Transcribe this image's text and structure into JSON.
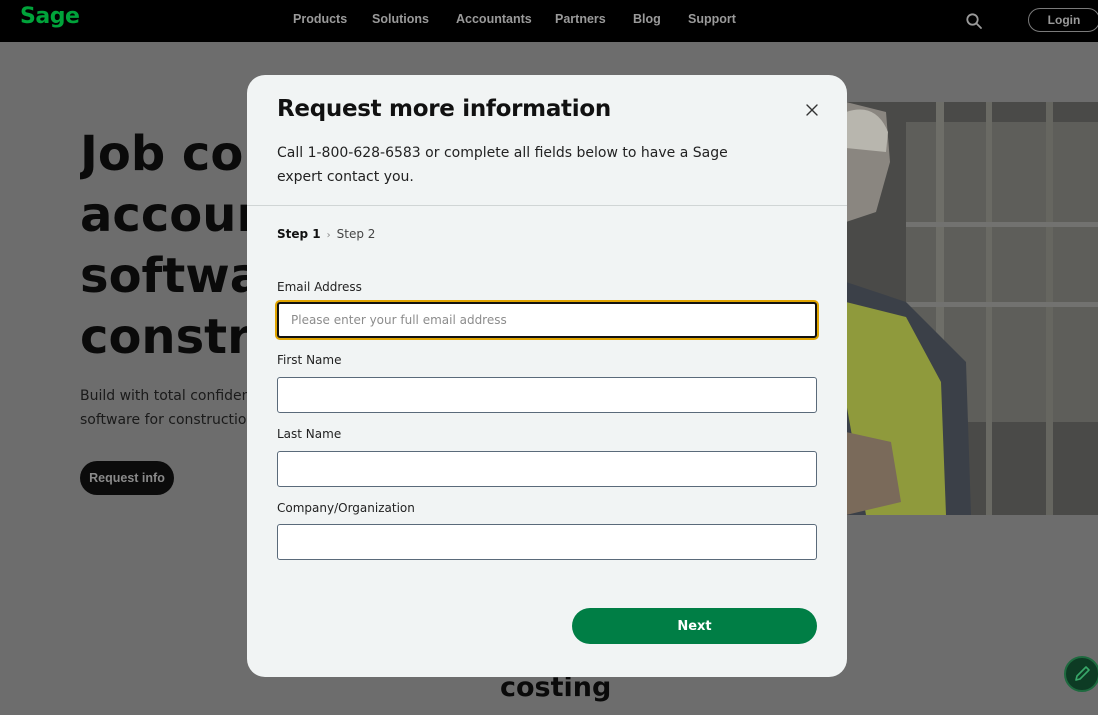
{
  "nav": {
    "logo": "Sage",
    "items": [
      "Products",
      "Solutions",
      "Accountants",
      "Partners",
      "Blog",
      "Support"
    ],
    "login_label": "Login",
    "search_icon": "search-icon"
  },
  "hero": {
    "heading_lines": [
      "Job co",
      "accour",
      "softwa",
      "constr"
    ],
    "text_lines": [
      "Build with total confiden",
      "software for construction"
    ],
    "button_label": "Request info"
  },
  "below": {
    "heading": "costing"
  },
  "modal": {
    "title": "Request more information",
    "description": "Call 1-800-628-6583 or complete all fields below to have a Sage expert contact you.",
    "steps": {
      "current": "Step 1",
      "separator": "›",
      "next": "Step 2"
    },
    "fields": {
      "email": {
        "label": "Email Address",
        "placeholder": "Please enter your full email address",
        "value": ""
      },
      "first_name": {
        "label": "First Name",
        "value": ""
      },
      "last_name": {
        "label": "Last Name",
        "value": ""
      },
      "company": {
        "label": "Company/Organization",
        "value": ""
      }
    },
    "next_label": "Next",
    "close_icon": "close-icon"
  },
  "colors": {
    "brand_green": "#00a33a",
    "button_green": "#007e45",
    "focus_ring": "#e0a400",
    "nav_bg": "#000000",
    "overlay_bg": "#6d6d6d"
  }
}
